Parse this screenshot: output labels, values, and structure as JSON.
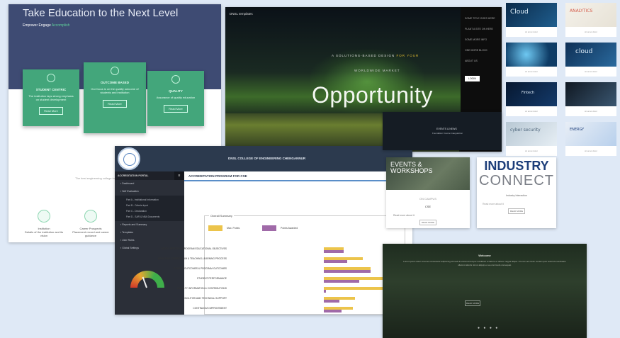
{
  "landing": {
    "title": "Take Education to the Next Level",
    "subtitle_a": "Empower Engage",
    "subtitle_b": "Accomplish",
    "cards": [
      {
        "title": "STUDENT CENTRIC",
        "text": "The institution lays strong emphasis on student development",
        "button": "Read More"
      },
      {
        "title": "OUTCOME BASED",
        "text": "Our focus is on the quality outcome of students and institution",
        "button": "Read More"
      },
      {
        "title": "QUALITY",
        "text": "Assurance of quality education",
        "button": "Read More"
      }
    ],
    "lower_title": "DNSL FL",
    "lower_text": "The best engineering college in the region for aspiring students",
    "minis": [
      {
        "label": "Institution",
        "text": "Details of the institution and its vision"
      },
      {
        "label": "Career Prospects",
        "text": "Placement record and career guidance"
      }
    ]
  },
  "hero": {
    "brand": "DNSL templates",
    "line1_a": "A SOLUTIONS-BASED DESIGN",
    "line1_b": "FOR YOUR",
    "line2": "WORLDWIDE MARKET",
    "headline": "Opportunity",
    "menu": [
      "SOME TITLE GOES HERE",
      "PLANT A SITE ON HERE",
      "SOME MORE INFO",
      "ONE MORE BLOCK",
      "ABOUT US"
    ],
    "menu_button": "LOGIN"
  },
  "thumbs": [
    {
      "label": "Cloud",
      "caption": "sit amet dolor"
    },
    {
      "label": "ANALYTICS",
      "caption": "sit amet dolor"
    },
    {
      "label": "",
      "caption": "sit amet dolor"
    },
    {
      "label": "cloud",
      "caption": "sit amet dolor"
    },
    {
      "label": "Fintech",
      "caption": "sit amet dolor"
    },
    {
      "label": "",
      "caption": "sit amet dolor"
    },
    {
      "label": "cyber security",
      "caption": "sit amet dolor"
    },
    {
      "label": "ENERGY",
      "caption": "sit amet dolor"
    }
  ],
  "admin": {
    "college": "DNSL COLLEGE OF ENGINEERING CHENGANNUR",
    "sidebar_title": "ACCREDITATION PORTAL",
    "menu": [
      {
        "label": "Dashboard"
      },
      {
        "label": "Self Evaluation"
      }
    ],
    "submenu": [
      "Part A - Institutional Information",
      "Part B - Criteria Input",
      "Part C - Declaration",
      "Part D - SAR & NBA Documents"
    ],
    "menu2": [
      "Reports and Summary",
      "Templates",
      "User Roles",
      "Global Settings"
    ],
    "page_title": "ACCREDITATION PROGRAM FOR CSE",
    "panel_legend": "Overall Summary",
    "series": [
      {
        "name": "Max. Points",
        "color": "#ecc44b"
      },
      {
        "name": "Points Awarded",
        "color": "#a06aa8"
      }
    ],
    "rows": [
      {
        "label": "VISION, MISSION & PROGRAM EDUCATIONAL OBJECTIVES",
        "max": 50,
        "awarded": 50
      },
      {
        "label": "PROGRAM, CURRICULUM & TEACHING-LEARNING PROCESS",
        "max": 100,
        "awarded": 60
      },
      {
        "label": "COURSE OUTCOMES & PROGRAM OUTCOMES",
        "max": 120,
        "awarded": 120
      },
      {
        "label": "STUDENT PERFORMANCE",
        "max": 150,
        "awarded": 90
      },
      {
        "label": "FACULTY INFORMATION & CONTRIBUTIONS",
        "max": 200,
        "awarded": 5
      },
      {
        "label": "FACILITIES AND TECHNICAL SUPPORT",
        "max": 80,
        "awarded": 40
      },
      {
        "label": "CONTINUOUS IMPROVEMENT",
        "max": 75,
        "awarded": 45
      }
    ]
  },
  "events_banner": {
    "title": "EVENTS & NEWS",
    "subtitle": "Foundation Course Inauguration"
  },
  "events_card": {
    "word1": "EVENTS &",
    "word2": "WORKSHOPS",
    "cap": "ON CAMPUS",
    "title": "CSE",
    "text": "Read more about it",
    "button": "READ MORE"
  },
  "industry_card": {
    "word1": "INDUSTRY",
    "word2": "CONNECT",
    "cap": "Industry Interaction",
    "text": "Read more about it",
    "button": "READ MORE"
  },
  "footer": {
    "heading": "Welcome",
    "para": "Lorem ipsum dolor sit amet consectetur adipiscing elit sed do eiusmod tempor incididunt ut labore et dolore magna aliqua. Ut enim ad minim veniam quis nostrud exercitation ullamco laboris nisi ut aliquip ex ea commodo consequat.",
    "button": "READ MORE",
    "dots": "● ● ● ●"
  }
}
